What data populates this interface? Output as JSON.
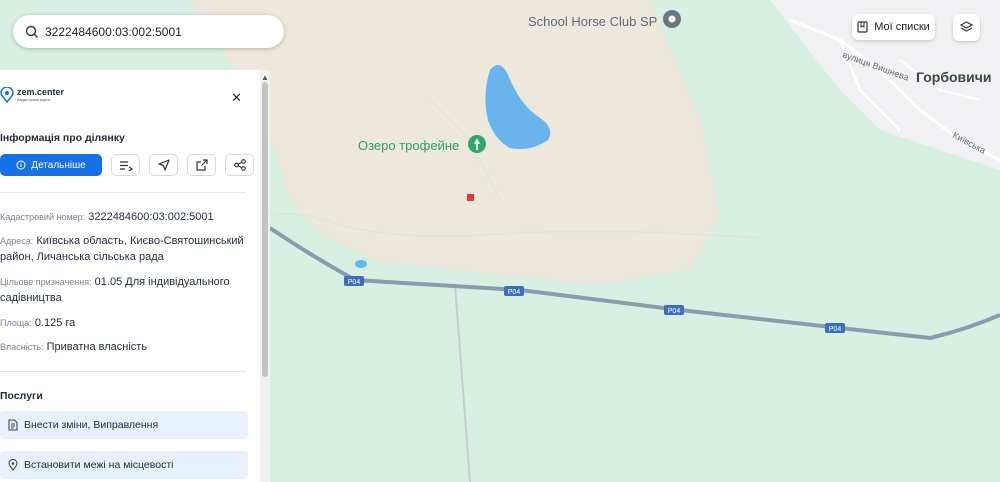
{
  "search": {
    "value": "3222484600:03:002:5001"
  },
  "map": {
    "labels": {
      "horse_club": "School Horse Club SP",
      "lake": "Озеро трофейне",
      "village": "Горбовичи",
      "street_vyshneva": "вулиця Вишнева",
      "street_kyivska": "Київська"
    },
    "road_shields": [
      "P04",
      "P04",
      "P04",
      "P04"
    ]
  },
  "toolbar": {
    "my_lists_label": "Мої списки",
    "layers_icon": "layers-icon"
  },
  "panel": {
    "logo": {
      "name": "zem.center",
      "subtitle": "Кадастрова карта"
    },
    "title": "Інформація про ділянку",
    "details_label": "Детальніше",
    "fields": {
      "cadastral_label": "Кадастровий номер:",
      "cadastral_value": "3222484600:03:002:5001",
      "address_label": "Адреса:",
      "address_value": "Київська область, Києво-Святошинський район, Личанська сільська рада",
      "purpose_label": "Цільове призначення:",
      "purpose_value": "01.05 Для індивідуального садівництва",
      "area_label": "Площа:",
      "area_value": "0.125 га",
      "ownership_label": "Власність:",
      "ownership_value": "Приватна власність"
    },
    "services_title": "Послуги",
    "services": [
      "Внести зміни, Виправлення",
      "Встановити межі на місцевості"
    ]
  }
}
